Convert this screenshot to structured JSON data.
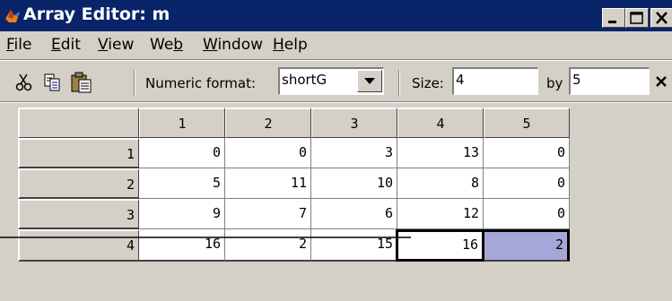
{
  "window": {
    "title": "Array Editor: m"
  },
  "menu": {
    "items": [
      {
        "label": "File",
        "ul": "F",
        "rest": "ile"
      },
      {
        "label": "Edit",
        "ul": "E",
        "rest": "dit"
      },
      {
        "label": "View",
        "ul": "V",
        "rest": "iew"
      },
      {
        "label": "Web",
        "pre": "We",
        "ul": "b",
        "rest": ""
      },
      {
        "label": "Window",
        "ul": "W",
        "rest": "indow"
      },
      {
        "label": "Help",
        "ul": "H",
        "rest": "elp"
      }
    ]
  },
  "toolbar": {
    "numeric_format_label": "Numeric format:",
    "numeric_format_value": "shortG",
    "size_label": "Size:",
    "size_rows": "4",
    "by_label": "by",
    "size_cols": "5",
    "close_glyph": "×"
  },
  "grid": {
    "col_headers": [
      "1",
      "2",
      "3",
      "4",
      "5"
    ],
    "row_headers": [
      "1",
      "2",
      "3",
      "4"
    ],
    "rows": [
      [
        "0",
        "0",
        "3",
        "13",
        "0"
      ],
      [
        "5",
        "11",
        "10",
        "8",
        "0"
      ],
      [
        "9",
        "7",
        "6",
        "12",
        "0"
      ],
      [
        "16",
        "2",
        "15",
        "16",
        "2"
      ]
    ],
    "active_cell": {
      "row": 4,
      "col": 4
    },
    "selected_cell": {
      "row": 4,
      "col": 5
    }
  },
  "colors": {
    "titlebar": "#0a246a",
    "selection": "#a6a6d8",
    "face": "#d4d0c8"
  }
}
